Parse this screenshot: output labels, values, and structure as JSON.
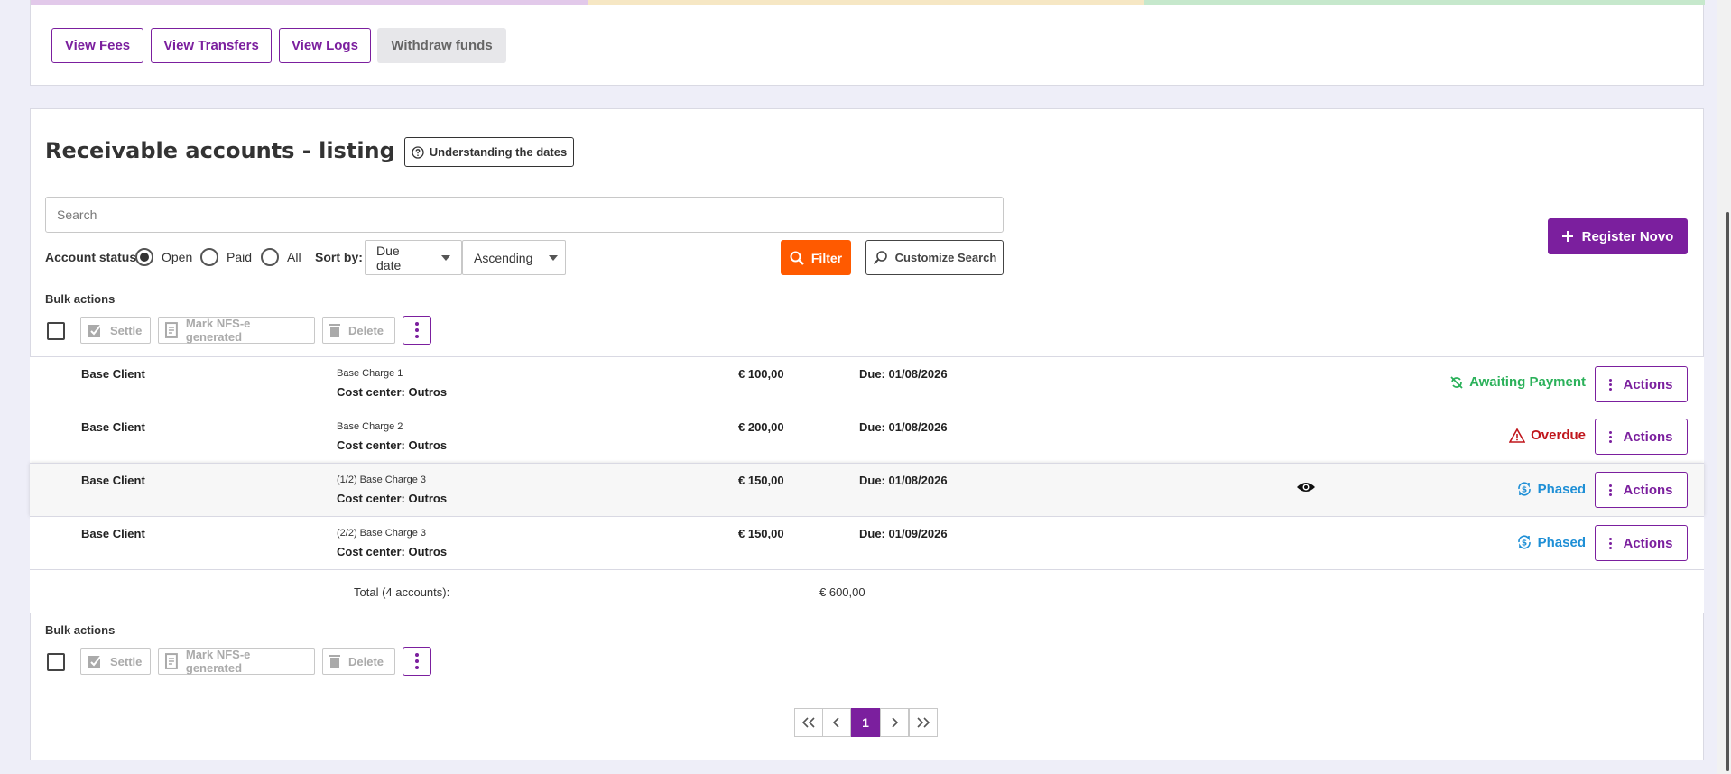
{
  "top_buttons": {
    "view_fees": "View Fees",
    "view_transfers": "View Transfers",
    "view_logs": "View Logs",
    "withdraw_funds": "Withdraw funds"
  },
  "listing": {
    "title": "Receivable accounts - listing",
    "understanding_dates": "Understanding the dates",
    "register_new": "Register Novo",
    "search_placeholder": "Search",
    "account_status_label": "Account status:",
    "status_options": [
      "Open",
      "Paid",
      "All"
    ],
    "status_selected": "Open",
    "sort_by_label": "Sort by:",
    "sort_field": "Due date",
    "sort_order": "Ascending",
    "filter_button": "Filter",
    "customize_search_button": "Customize Search"
  },
  "bulk_actions": {
    "label": "Bulk actions",
    "settle": "Settle",
    "mark_nfse": "Mark NFS-e generated",
    "delete": "Delete"
  },
  "rows": [
    {
      "client": "Base Client",
      "charge": "Base Charge 1",
      "cost_center": "Cost center: Outros",
      "amount": "€ 100,00",
      "due": "Due: 01/08/2026",
      "status": "Awaiting Payment",
      "status_color": "#2bb15a",
      "action": "Actions"
    },
    {
      "client": "Base Client",
      "charge": "Base Charge 2",
      "cost_center": "Cost center: Outros",
      "amount": "€ 200,00",
      "due": "Due: 01/08/2026",
      "status": "Overdue",
      "status_color": "#c0161c",
      "action": "Actions"
    },
    {
      "client": "Base Client",
      "charge": "(1/2) Base Charge 3",
      "cost_center": "Cost center: Outros",
      "amount": "€ 150,00",
      "due": "Due: 01/08/2026",
      "status": "Phased",
      "status_color": "#1e8fd6",
      "action": "Actions"
    },
    {
      "client": "Base Client",
      "charge": "(2/2) Base Charge 3",
      "cost_center": "Cost center: Outros",
      "amount": "€ 150,00",
      "due": "Due: 01/09/2026",
      "status": "Phased",
      "status_color": "#1e8fd6",
      "action": "Actions"
    }
  ],
  "total": {
    "label": "Total (4 accounts):",
    "value": "€ 600,00"
  },
  "pagination": {
    "current_page": "1"
  },
  "colors": {
    "brand_purple": "#7b1f9e",
    "filter_orange": "#ff5a00"
  }
}
